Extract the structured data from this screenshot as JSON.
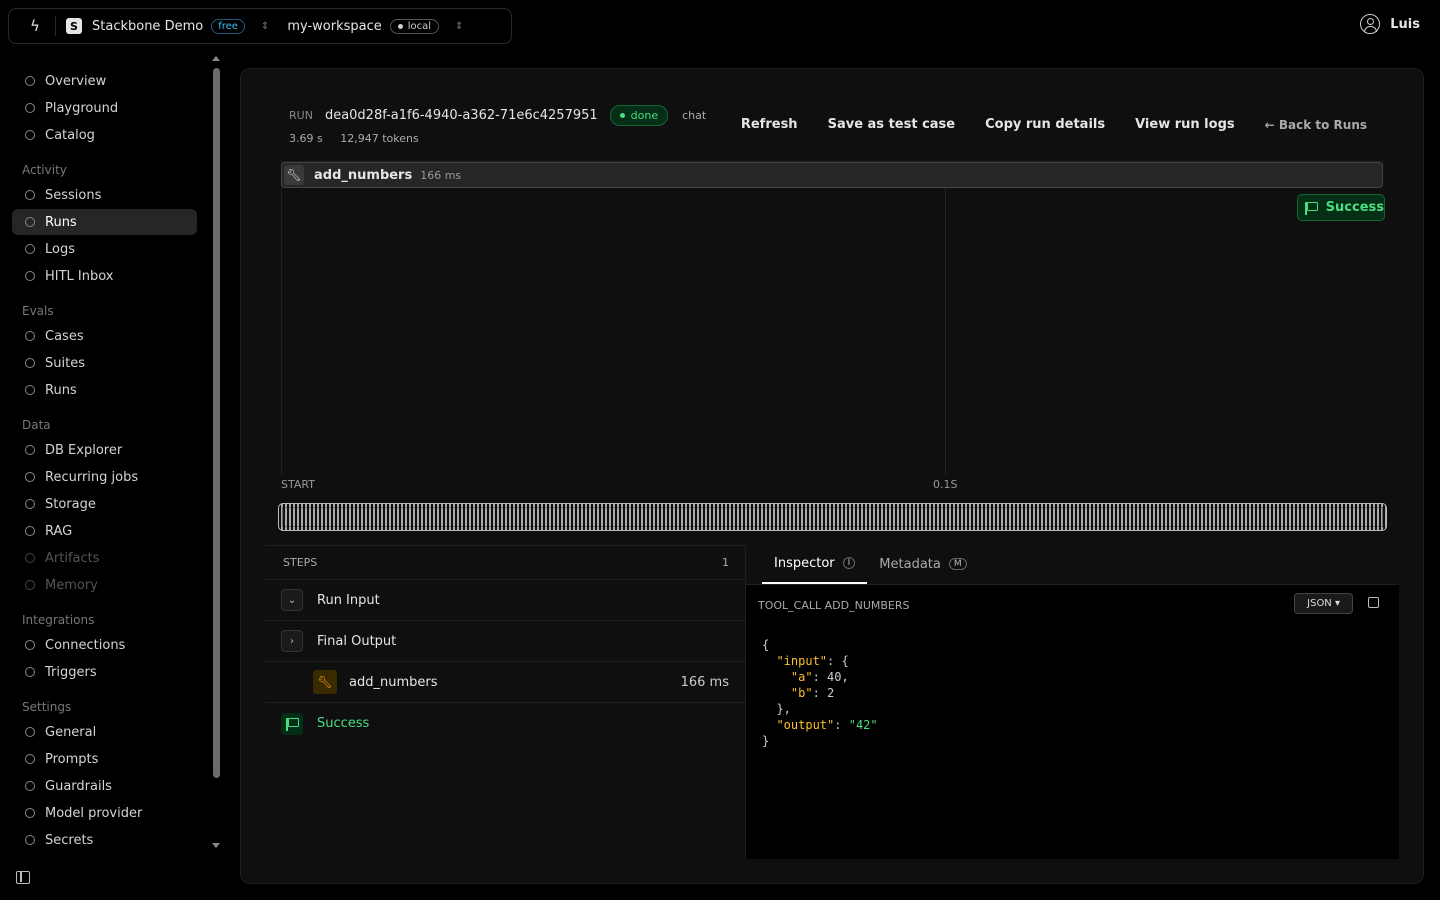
{
  "topbar": {
    "org_initial": "S",
    "org_name": "Stackbone Demo",
    "org_plan": "free",
    "workspace_name": "my-workspace",
    "workspace_env": "local"
  },
  "user": {
    "name": "Luis"
  },
  "sidebar": {
    "items": [
      {
        "label": "Overview"
      },
      {
        "label": "Playground"
      },
      {
        "label": "Catalog"
      }
    ],
    "groups": {
      "activity": {
        "title": "Activity",
        "items": [
          {
            "label": "Sessions"
          },
          {
            "label": "Runs"
          },
          {
            "label": "Logs"
          },
          {
            "label": "HITL Inbox"
          }
        ]
      },
      "evals": {
        "title": "Evals",
        "items": [
          {
            "label": "Cases"
          },
          {
            "label": "Suites"
          },
          {
            "label": "Runs"
          }
        ]
      },
      "data": {
        "title": "Data",
        "items": [
          {
            "label": "DB Explorer"
          },
          {
            "label": "Recurring jobs"
          },
          {
            "label": "Storage"
          },
          {
            "label": "RAG"
          },
          {
            "label": "Artifacts"
          },
          {
            "label": "Memory"
          }
        ]
      },
      "integrations": {
        "title": "Integrations",
        "items": [
          {
            "label": "Connections"
          },
          {
            "label": "Triggers"
          }
        ]
      },
      "settings": {
        "title": "Settings",
        "items": [
          {
            "label": "General"
          },
          {
            "label": "Prompts"
          },
          {
            "label": "Guardrails"
          },
          {
            "label": "Model provider"
          },
          {
            "label": "Secrets"
          }
        ]
      }
    }
  },
  "run": {
    "label": "RUN",
    "id": "dea0d28f-a1f6-4940-a362-71e6c4257951",
    "status": "done",
    "type": "chat",
    "duration": "3.69 s",
    "tokens": "12,947 tokens"
  },
  "actions": {
    "refresh": "Refresh",
    "save_test": "Save as test case",
    "copy_details": "Copy run details",
    "view_logs": "View run logs",
    "back": "← Back to Runs"
  },
  "timeline": {
    "span_name": "add_numbers",
    "span_ms": "166 ms",
    "success_label": "Success",
    "axis_start": "START",
    "axis_mid": "0.1S"
  },
  "steps": {
    "header": "STEPS",
    "count": "1",
    "run_input": "Run Input",
    "final_output": "Final Output",
    "tool_name": "add_numbers",
    "tool_ms": "166 ms",
    "success": "Success"
  },
  "inspector": {
    "tab_inspector": "Inspector",
    "tab_inspector_key": "I",
    "tab_metadata": "Metadata",
    "tab_metadata_key": "M",
    "subtitle": "TOOL_CALL ADD_NUMBERS",
    "format": "JSON ▾",
    "json": {
      "input": {
        "a": 40,
        "b": 2
      },
      "output": "42"
    }
  }
}
